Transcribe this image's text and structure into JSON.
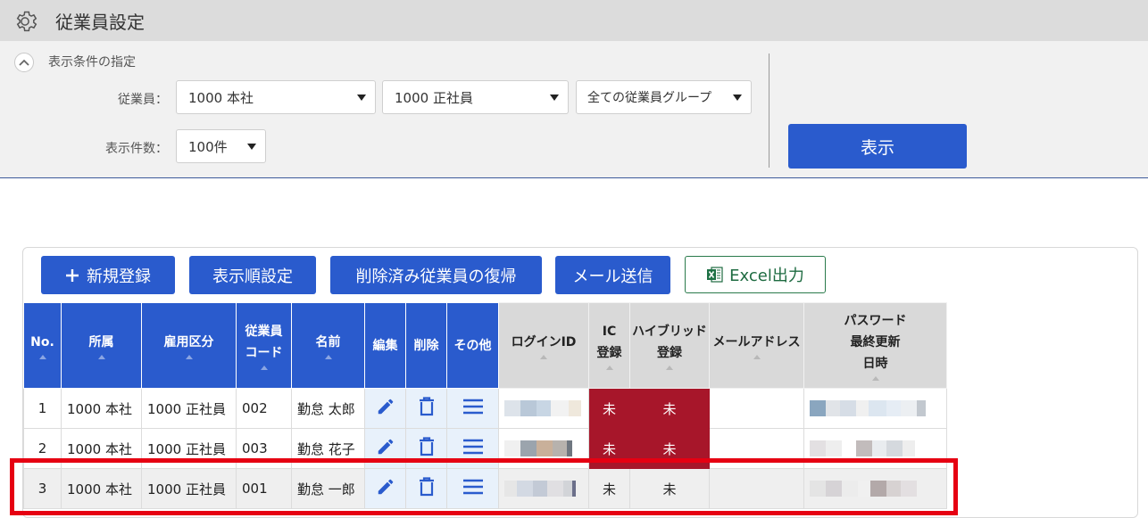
{
  "header": {
    "title": "従業員設定",
    "icon": "gear-icon"
  },
  "filter": {
    "title": "表示条件の指定",
    "employee_label": "従業員：",
    "count_label": "表示件数：",
    "office_select": "1000 本社",
    "employment_select": "1000 正社員",
    "group_select": "全ての従業員グループ",
    "count_select": "100件",
    "show_button": "表示"
  },
  "toolbar": {
    "new_button": "新規登録",
    "order_button": "表示順設定",
    "restore_button": "削除済み従業員の復帰",
    "mail_button": "メール送信",
    "excel_button": "Excel出力"
  },
  "table": {
    "headers": {
      "no": "No.",
      "office": "所属",
      "employment": "雇用区分",
      "code_line1": "従業員",
      "code_line2": "コード",
      "name": "名前",
      "edit": "編集",
      "delete": "削除",
      "other": "その他",
      "login": "ログインID",
      "ic_line1": "IC",
      "ic_line2": "登録",
      "hybrid_line1": "ハイブリッド",
      "hybrid_line2": "登録",
      "mail": "メールアドレス",
      "pw_line1": "パスワード",
      "pw_line2": "最終更新",
      "pw_line3": "日時"
    },
    "rows": [
      {
        "no": "1",
        "office": "1000 本社",
        "employment": "1000 正社員",
        "code": "002",
        "name": "勤怠 太郎",
        "ic": "未",
        "hybrid": "未"
      },
      {
        "no": "2",
        "office": "1000 本社",
        "employment": "1000 正社員",
        "code": "003",
        "name": "勤怠 花子",
        "ic": "未",
        "hybrid": "未"
      },
      {
        "no": "3",
        "office": "1000 本社",
        "employment": "1000 正社員",
        "code": "001",
        "name": "勤怠 一郎",
        "ic": "未",
        "hybrid": "未"
      }
    ]
  },
  "colors": {
    "primary": "#2a5bcd",
    "unregistered": "#a7162a",
    "highlight": "#e60012",
    "excel": "#1e6b41"
  }
}
